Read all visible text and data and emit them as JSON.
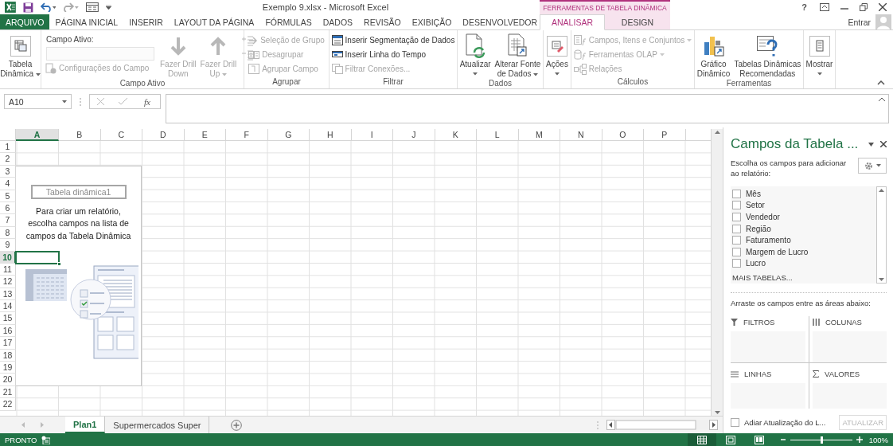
{
  "title_bar": {
    "title": "Exemplo 9.xlsx - Microsoft Excel",
    "context_header": "FERRAMENTAS DE TABELA DINÂMICA",
    "help": "?"
  },
  "tabs": [
    {
      "label": "ARQUIVO",
      "kind": "file",
      "selected": false
    },
    {
      "label": "PÁGINA INICIAL",
      "kind": "main",
      "selected": false
    },
    {
      "label": "INSERIR",
      "kind": "main",
      "selected": false
    },
    {
      "label": "LAYOUT DA PÁGINA",
      "kind": "main",
      "selected": false
    },
    {
      "label": "FÓRMULAS",
      "kind": "main",
      "selected": false
    },
    {
      "label": "DADOS",
      "kind": "main",
      "selected": false
    },
    {
      "label": "REVISÃO",
      "kind": "main",
      "selected": false
    },
    {
      "label": "EXIBIÇÃO",
      "kind": "main",
      "selected": false
    },
    {
      "label": "DESENVOLVEDOR",
      "kind": "main",
      "selected": false
    },
    {
      "label": "ANALISAR",
      "kind": "context",
      "selected": true
    },
    {
      "label": "DESIGN",
      "kind": "context",
      "selected": false
    }
  ],
  "account": {
    "label": "Entrar"
  },
  "ribbon": {
    "groups": [
      {
        "items": [
          {
            "kind": "large",
            "lines": [
              "Tabela",
              "Dinâmica"
            ],
            "dropdown": true,
            "disabled": false
          }
        ]
      },
      {
        "name": "Campo Ativo",
        "items": [
          {
            "kind": "stack",
            "items": [
              {
                "kind": "label",
                "label": "Campo Ativo:"
              },
              {
                "kind": "field",
                "disabled": true
              },
              {
                "kind": "small",
                "label": "Configurações do Campo",
                "disabled": true
              }
            ]
          },
          {
            "kind": "large",
            "lines": [
              "Fazer Drill",
              "Down"
            ],
            "disabled": true
          },
          {
            "kind": "large",
            "lines": [
              "Fazer Drill",
              "Up"
            ],
            "dropdown": true,
            "disabled": true
          },
          {
            "kind": "stack",
            "items": [
              {
                "kind": "small",
                "disabled": true
              },
              {
                "kind": "small",
                "disabled": true
              }
            ]
          }
        ]
      },
      {
        "name": "Agrupar",
        "items": [
          {
            "kind": "stack",
            "items": [
              {
                "kind": "small",
                "label": "Seleção de Grupo",
                "disabled": true
              },
              {
                "kind": "small",
                "label": "Desagrupar",
                "disabled": true
              },
              {
                "kind": "small",
                "label": "Agrupar Campo",
                "disabled": true
              }
            ]
          }
        ]
      },
      {
        "name": "Filtrar",
        "items": [
          {
            "kind": "stack",
            "items": [
              {
                "kind": "small",
                "label": "Inserir Segmentação de Dados",
                "disabled": false
              },
              {
                "kind": "small",
                "label": "Inserir Linha do Tempo",
                "disabled": false
              },
              {
                "kind": "small",
                "label": "Filtrar Conexões...",
                "disabled": true
              }
            ]
          }
        ]
      },
      {
        "name": "Dados",
        "items": [
          {
            "kind": "large",
            "lines": [
              "Atualizar"
            ],
            "dropdown": true,
            "disabled": false
          },
          {
            "kind": "large",
            "lines": [
              "Alterar Fonte",
              "de Dados"
            ],
            "dropdown": true,
            "disabled": false
          }
        ]
      },
      {
        "items": [
          {
            "kind": "large",
            "lines": [
              "Ações"
            ],
            "dropdown": true,
            "disabled": false
          }
        ]
      },
      {
        "name": "Cálculos",
        "items": [
          {
            "kind": "stack",
            "items": [
              {
                "kind": "small",
                "label": "Campos, Itens e Conjuntos",
                "dropdown": true,
                "disabled": true
              },
              {
                "kind": "small",
                "label": "Ferramentas OLAP",
                "dropdown": true,
                "disabled": true
              },
              {
                "kind": "small",
                "label": "Relações",
                "disabled": true
              }
            ]
          }
        ]
      },
      {
        "name": "Ferramentas",
        "items": [
          {
            "kind": "large",
            "lines": [
              "Gráfico",
              "Dinâmico"
            ],
            "disabled": false
          },
          {
            "kind": "large",
            "lines": [
              "Tabelas Dinâmicas",
              "Recomendadas"
            ],
            "disabled": false
          }
        ]
      },
      {
        "items": [
          {
            "kind": "large",
            "lines": [
              "Mostrar"
            ],
            "dropdown": true,
            "disabled": false
          }
        ]
      }
    ]
  },
  "formula_bar": {
    "name_box": "A10",
    "function_label": "fx"
  },
  "sheet": {
    "columns": [
      {
        "label": "A",
        "selected": true
      },
      {
        "label": "B",
        "selected": false
      },
      {
        "label": "C",
        "selected": false
      },
      {
        "label": "D",
        "selected": false
      },
      {
        "label": "E",
        "selected": false
      },
      {
        "label": "F",
        "selected": false
      },
      {
        "label": "G",
        "selected": false
      },
      {
        "label": "H",
        "selected": false
      },
      {
        "label": "I",
        "selected": false
      },
      {
        "label": "J",
        "selected": false
      },
      {
        "label": "K",
        "selected": false
      },
      {
        "label": "L",
        "selected": false
      },
      {
        "label": "M",
        "selected": false
      },
      {
        "label": "N",
        "selected": false
      },
      {
        "label": "O",
        "selected": false
      },
      {
        "label": "P",
        "selected": false
      }
    ],
    "rows": [
      {
        "label": "1",
        "selected": false
      },
      {
        "label": "2",
        "selected": false
      },
      {
        "label": "3",
        "selected": false
      },
      {
        "label": "4",
        "selected": false
      },
      {
        "label": "5",
        "selected": false
      },
      {
        "label": "6",
        "selected": false
      },
      {
        "label": "7",
        "selected": false
      },
      {
        "label": "8",
        "selected": false
      },
      {
        "label": "9",
        "selected": false
      },
      {
        "label": "10",
        "selected": true
      },
      {
        "label": "11",
        "selected": false
      },
      {
        "label": "12",
        "selected": false
      },
      {
        "label": "13",
        "selected": false
      },
      {
        "label": "14",
        "selected": false
      },
      {
        "label": "15",
        "selected": false
      },
      {
        "label": "16",
        "selected": false
      },
      {
        "label": "17",
        "selected": false
      },
      {
        "label": "18",
        "selected": false
      },
      {
        "label": "19",
        "selected": false
      },
      {
        "label": "20",
        "selected": false
      },
      {
        "label": "21",
        "selected": false
      },
      {
        "label": "22",
        "selected": false
      }
    ]
  },
  "pivot_placeholder": {
    "name": "Tabela dinâmica1",
    "message": "Para criar um relatório, escolha campos na lista de campos da Tabela Dinâmica"
  },
  "sheet_tabs": [
    {
      "label": "Plan1",
      "selected": true
    },
    {
      "label": "Supermercados Super",
      "selected": false
    }
  ],
  "field_list": {
    "title": "Campos da Tabela ...",
    "instruction": "Escolha os campos para adicionar ao relatório:",
    "fields": [
      {
        "label": "Mês",
        "checked": false
      },
      {
        "label": "Setor",
        "checked": false
      },
      {
        "label": "Vendedor",
        "checked": false
      },
      {
        "label": "Região",
        "checked": false
      },
      {
        "label": "Faturamento",
        "checked": false
      },
      {
        "label": "Margem de Lucro",
        "checked": false
      },
      {
        "label": "Lucro",
        "checked": false
      }
    ],
    "more_tables": "MAIS TABELAS...",
    "drag_hint": "Arraste os campos entre as áreas abaixo:",
    "areas": [
      {
        "label": "FILTROS",
        "kind": "filters"
      },
      {
        "label": "COLUNAS",
        "kind": "columns"
      },
      {
        "label": "LINHAS",
        "kind": "rows"
      },
      {
        "label": "VALORES",
        "kind": "values"
      }
    ],
    "defer_update": {
      "label": "Adiar Atualização do L...",
      "checked": false
    },
    "update_button": {
      "label": "ATUALIZAR",
      "disabled": true
    }
  },
  "status_bar": {
    "mode": "PRONTO",
    "views": [
      {
        "selected": true
      },
      {
        "selected": false
      },
      {
        "selected": false
      }
    ],
    "zoom_slider": {
      "level": 0.5
    },
    "zoom": "100%"
  }
}
